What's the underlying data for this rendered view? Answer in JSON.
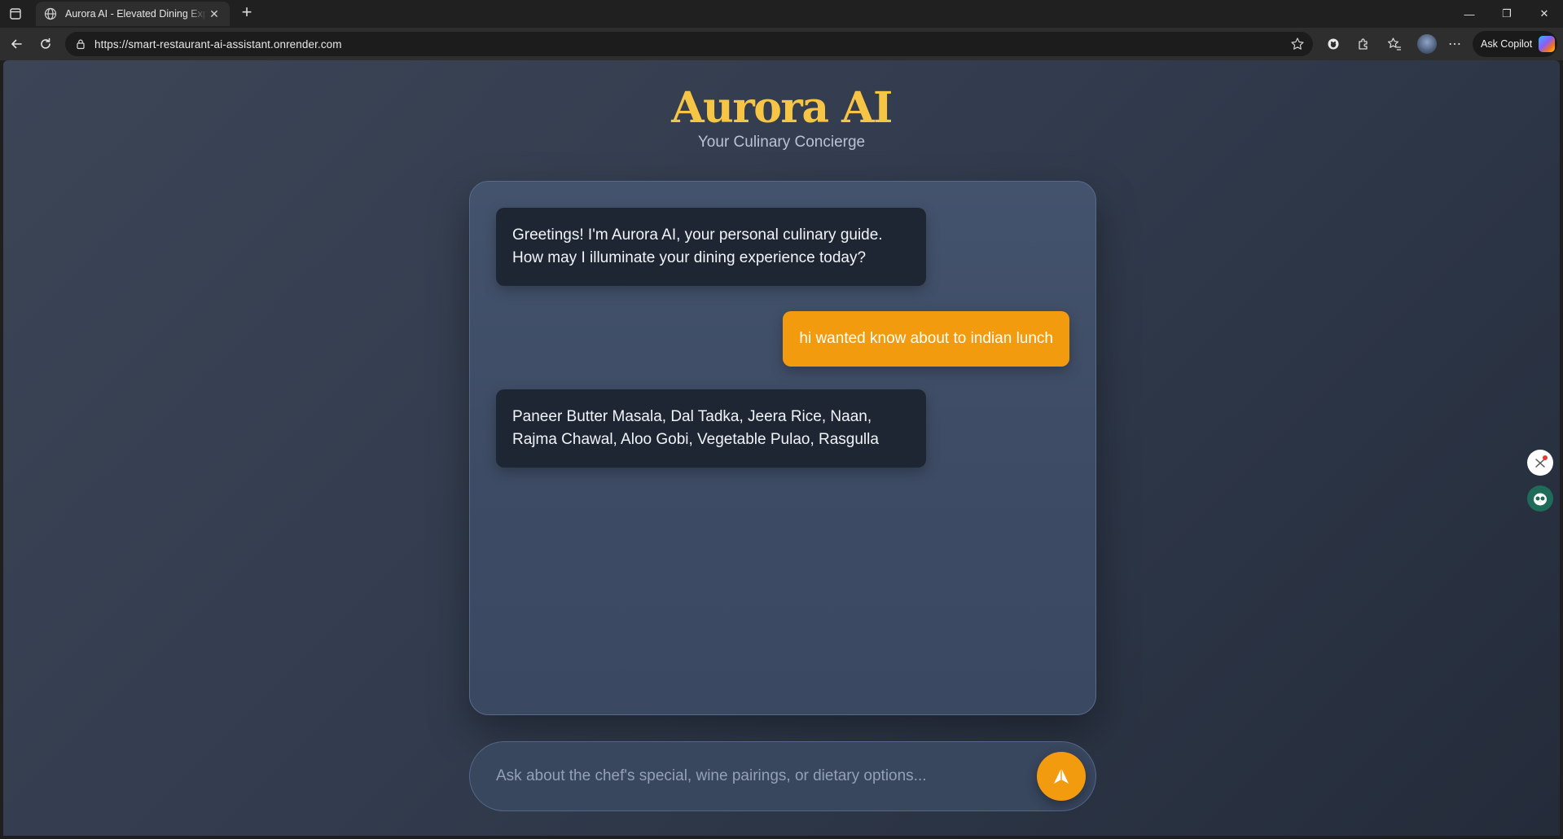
{
  "browser": {
    "tab_title": "Aurora AI - Elevated Dining Experience",
    "tab_close": "✕",
    "new_tab": "+",
    "url": "https://smart-restaurant-ai-assistant.onrender.com",
    "copilot_label": "Ask Copilot",
    "more_icon": "⋯",
    "window_controls": {
      "minimize": "—",
      "restore": "❐",
      "close": "✕"
    }
  },
  "header": {
    "title": "Aurora AI",
    "subtitle": "Your Culinary Concierge"
  },
  "messages": [
    {
      "role": "bot",
      "text": "Greetings! I'm Aurora AI, your personal culinary guide. How may I illuminate your dining experience today?"
    },
    {
      "role": "user",
      "text": "hi wanted know about to indian lunch"
    },
    {
      "role": "bot",
      "text": "Paneer Butter Masala, Dal Tadka, Jeera Rice, Naan, Rajma Chawal, Aloo Gobi, Vegetable Pulao, Rasgulla"
    }
  ],
  "composer": {
    "placeholder": "Ask about the chef's special, wine pairings, or dietary options..."
  },
  "colors": {
    "accent": "#f39b0f",
    "title": "#f6c545",
    "bot_bubble": "#1f2633",
    "card": "#3d4b64"
  },
  "icons": [
    "window-icon",
    "globe-icon",
    "back-icon",
    "refresh-icon",
    "lock-icon",
    "star-icon",
    "extension-icon",
    "puzzle-icon",
    "favorites-icon",
    "profile-icon",
    "copilot-icon",
    "send-icon",
    "shortcut-icon",
    "owl-icon"
  ]
}
